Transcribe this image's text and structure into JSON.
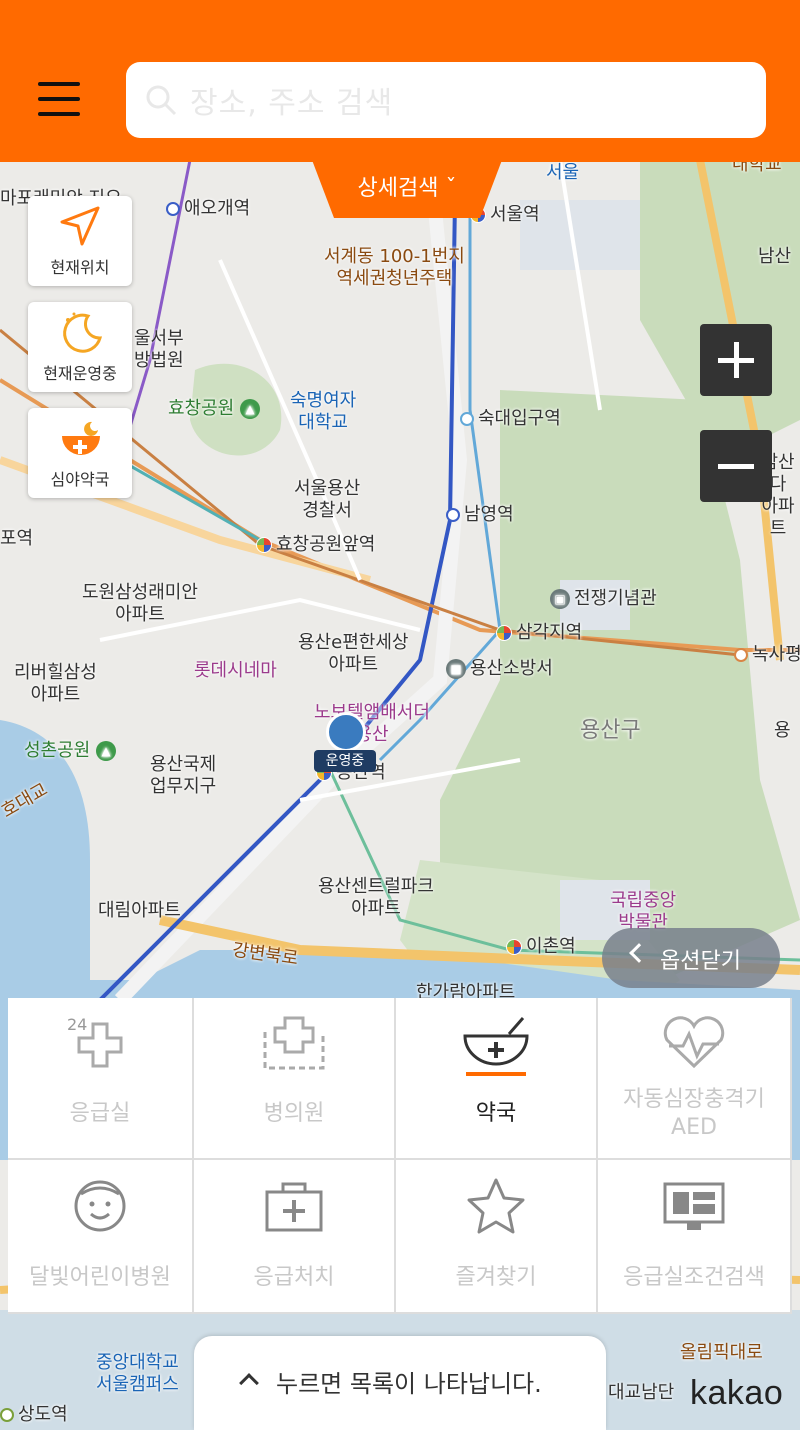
{
  "header": {
    "search_placeholder": "장소, 주소 검색",
    "detail_search_label": "상세검색 ˇ"
  },
  "side_buttons": {
    "current_location": "현재위치",
    "open_now": "현재운영중",
    "late_night_pharmacy": "심야약국"
  },
  "map": {
    "labels": {
      "aeogae": "애오개역",
      "seoul_station": "서울역",
      "seoul_top": "서울",
      "seogye": "서계동 100-1번지\n역세권청년주택",
      "seoul_court": "울서부\n방법원",
      "hyochang_park": "효창공원",
      "sookmyung": "숙명여자\n대학교",
      "sookdae_station": "숙대입구역",
      "police": "서울용산\n경찰서",
      "namyeong": "남영역",
      "hyochang_station": "효창공원앞역",
      "dowon": "도원삼성래미안\n아파트",
      "war_memorial": "전쟁기념관",
      "samgakji": "삼각지역",
      "riverhill": "리버힐삼성\n아파트",
      "lotte_cinema": "롯데시네마",
      "yongsan_e": "용산e편한세상\n아파트",
      "fire_station": "용산소방서",
      "noksapyeong": "녹사평",
      "novotel": "노보텔앰배서더\n용산",
      "yongsan_gu": "용산구",
      "seongchon_park": "성촌공원",
      "intl_business": "용산국제\n업무지구",
      "yongsan_station": "용산역",
      "central_park": "용산센트럴파크\n아파트",
      "daerim": "대림아파트",
      "museum": "국립중앙\n박물관",
      "ichon": "이촌역",
      "gangbyeon": "강변북로",
      "hangang_apt": "한가람아파트",
      "namsan": "남산",
      "namsan2": "남산다\n아파트",
      "university_top": "대학교",
      "chung_ang": "중앙대학교\n서울캠퍼스",
      "sangdo": "상도역",
      "olympic": "올림픽대로",
      "daegyo": "대교남단",
      "mapo": "마포래미안\n지오",
      "podo": "포역",
      "yong": "용",
      "left_road": "호대교"
    },
    "marker_tag": "운영중"
  },
  "zoom": {
    "in": "+",
    "out": "−"
  },
  "close_options_label": "옵션닫기",
  "categories": [
    {
      "label": "응급실",
      "icon": "emergency-24-icon",
      "active": false
    },
    {
      "label": "병의원",
      "icon": "hospital-icon",
      "active": false
    },
    {
      "label": "약국",
      "icon": "pharmacy-bowl-icon",
      "active": true
    },
    {
      "label": "자동심장충격기\nAED",
      "icon": "heart-pulse-icon",
      "active": false
    },
    {
      "label": "달빛어린이병원",
      "icon": "child-face-icon",
      "active": false
    },
    {
      "label": "응급처치",
      "icon": "first-aid-kit-icon",
      "active": false
    },
    {
      "label": "즐겨찾기",
      "icon": "star-icon",
      "active": false
    },
    {
      "label": "응급실조건검색",
      "icon": "monitor-icon",
      "active": false
    }
  ],
  "list_toggle_label": "누르면 목록이 나타납니다.",
  "brand": "kakao",
  "colors": {
    "accent": "#ff6a00",
    "zoom_bg": "#333333"
  }
}
